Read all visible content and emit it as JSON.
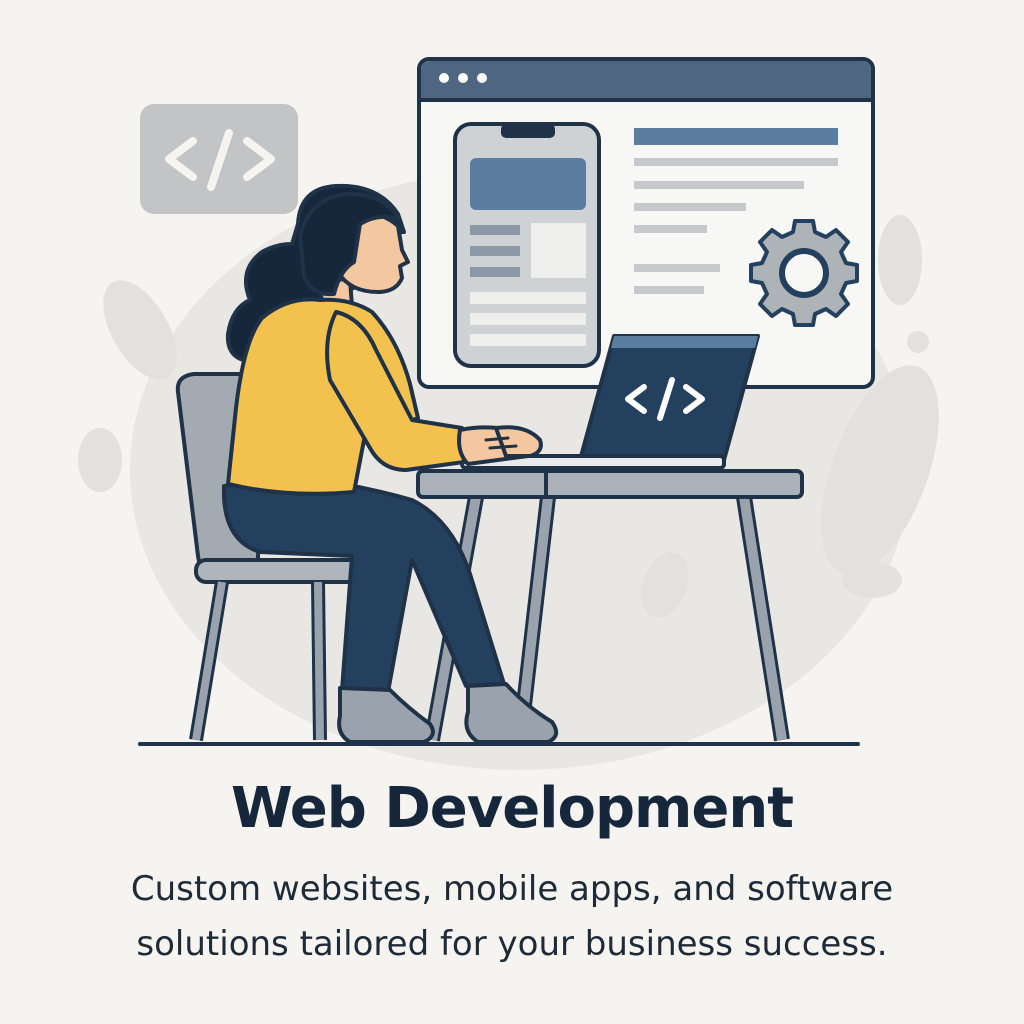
{
  "heading": {
    "title": "Web Development",
    "description": "Custom websites, mobile apps, and software solutions tailored for your business success."
  },
  "illustration": {
    "code_badge_text": "</>",
    "laptop_screen_text": "</>",
    "icons": [
      "code-icon",
      "gear-icon",
      "window-dots-icon"
    ]
  },
  "colors": {
    "background": "#f5f4f1",
    "navy": "#24405f",
    "slate_blue": "#5b7d9f",
    "mustard": "#f2c14e",
    "grey": "#9aa3ad",
    "title": "#17273b"
  }
}
